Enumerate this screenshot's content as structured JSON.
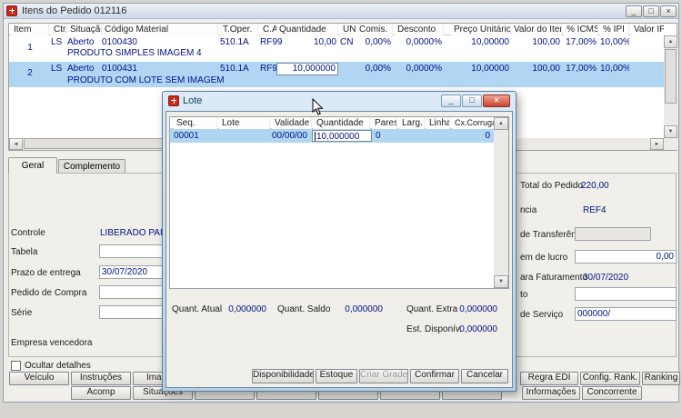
{
  "colors": {
    "accent_navy": "#001284",
    "selection_blue": "#b0d6f4",
    "close_red": "#c6452f",
    "titlebar_blue": "#cdd9e7"
  },
  "window": {
    "title": "Itens do Pedido 012116",
    "controls": {
      "minimize": "_",
      "maximize": "□",
      "close": "×"
    }
  },
  "grid": {
    "cols": [
      "Item",
      "Ctr.",
      "Situação",
      "Código Material",
      "T.Oper.",
      "C.A.",
      "Quantidade",
      "UNI",
      "Comis.",
      "Desconto",
      "Preço Unitário",
      "Valor do Item",
      "% ICMS",
      "% IPI",
      "Valor IPI"
    ],
    "rows": [
      {
        "item": "1",
        "ctr": "LS",
        "situacao": "Aberto",
        "codigo": "0100430",
        "toper": "510.1A",
        "ca": "RF99",
        "quantidade": "10,00",
        "uni": "CN",
        "comis": "0,00%",
        "desconto": "0,0000%",
        "preco_unitario": "10,00000",
        "valor_item": "100,00",
        "icms": "17,00%",
        "ipi": "10,00%",
        "valor_ipi": "",
        "descricao": "PRODUTO SIMPLES IMAGEM 4"
      },
      {
        "item": "2",
        "ctr": "LS",
        "situacao": "Aberto",
        "codigo": "0100431",
        "toper": "510.1A",
        "ca": "RF99",
        "quantidade": "10,000000",
        "uni": "",
        "comis": "0,00%",
        "desconto": "0,0000%",
        "preco_unitario": "10,00000",
        "valor_item": "100,00",
        "icms": "17,00%",
        "ipi": "10,00%",
        "valor_ipi": "",
        "descricao": "PRODUTO COM LOTE SEM IMAGEM"
      }
    ]
  },
  "tabs": {
    "geral": "Geral",
    "complemento": "Complemento"
  },
  "form_left": {
    "controle_label": "Controle",
    "controle_value": "LIBERADO PARA S",
    "tabela_label": "Tabela",
    "tabela_value": "",
    "prazo_label": "Prazo de entrega",
    "prazo_value": "30/07/2020",
    "pedido_compra_label": "Pedido de Compra",
    "pedido_compra_value": "",
    "serie_label": "Série",
    "serie_value": "",
    "empresa_label": "Empresa vencedora"
  },
  "form_right": {
    "total_label": "Total do Pedido",
    "total_value": "220,00",
    "referencia_label": "ncia",
    "referencia_value": "REF4",
    "transferencia_label": "de Transferência",
    "transferencia_value": "",
    "lucro_label": "em de lucro",
    "lucro_value": "0,00",
    "faturamento_label": "ara Faturamento",
    "faturamento_value": "30/07/2020",
    "to_label": "to",
    "to_value": "",
    "servico_label": "de Serviço",
    "servico_value": "000000/"
  },
  "footer": {
    "ocultar": "Ocultar detalhes",
    "veiculo": "Veículo",
    "instrucoes": "Instruções",
    "imagem": "Imagem",
    "regra_edi": "Regra EDI",
    "config_rank": "Config. Rank.",
    "ranking": "Ranking",
    "acomp": "Acomp",
    "situacoes": "Situações",
    "informacoes": "Informações",
    "concorrente": "Concorrente"
  },
  "modal": {
    "title": "Lote",
    "controls": {
      "minimize": "_",
      "maximize": "□",
      "close": "×"
    },
    "cols": [
      "Seq.",
      "Lote",
      "Validade",
      "Quantidade",
      "Pares",
      "Larg.",
      "Linha",
      "Cx.Corrugadas"
    ],
    "row": {
      "seq": "00001",
      "lote": "",
      "validade": "00/00/00",
      "quantidade": "10,000000",
      "pares": "0",
      "larg": "",
      "linha": "",
      "cx": "0"
    },
    "summary": {
      "atual_label": "Quant. Atual",
      "atual_value": "0,000000",
      "saldo_label": "Quant. Saldo",
      "saldo_value": "0,000000",
      "extra_label": "Quant. Extra",
      "extra_value": "0,000000",
      "disponivel_label": "Est. Disponív.",
      "disponivel_value": "0,000000"
    },
    "buttons": {
      "disponibilidade": "Disponibilidade",
      "estoque": "Estoque",
      "criar_grade": "Criar Grade",
      "confirmar": "Confirmar",
      "cancelar": "Cancelar"
    }
  }
}
